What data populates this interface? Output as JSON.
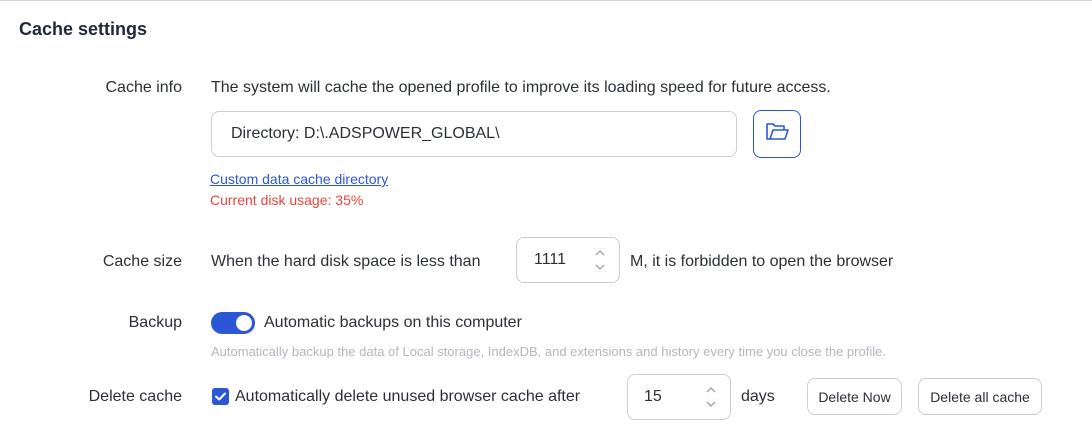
{
  "section": {
    "title": "Cache settings"
  },
  "cache_info": {
    "label": "Cache info",
    "description": "The system will cache the opened profile to improve its loading speed for future access.",
    "directory_value": "Directory: D:\\.ADSPOWER_GLOBAL\\",
    "folder_icon": "folder-open-icon",
    "custom_link": "Custom data cache directory",
    "disk_usage": "Current disk usage: 35%"
  },
  "cache_size": {
    "label": "Cache size",
    "prefix": "When the hard disk space is less than",
    "value": "1111",
    "suffix": "M, it is forbidden to open the browser"
  },
  "backup": {
    "label": "Backup",
    "toggle_on": true,
    "toggle_label": "Automatic backups on this computer",
    "hint": "Automatically backup the data of Local storage, IndexDB, and extensions and history every time you close the profile."
  },
  "delete_cache": {
    "label": "Delete cache",
    "checked": true,
    "checkbox_label": "Automatically delete unused browser cache after",
    "days_value": "15",
    "days_unit": "days",
    "delete_now": "Delete Now",
    "delete_all": "Delete all cache"
  },
  "colors": {
    "accent": "#2b56d6",
    "danger": "#e8453c",
    "hint": "#b2b7bf",
    "border": "#c9cdd4"
  }
}
